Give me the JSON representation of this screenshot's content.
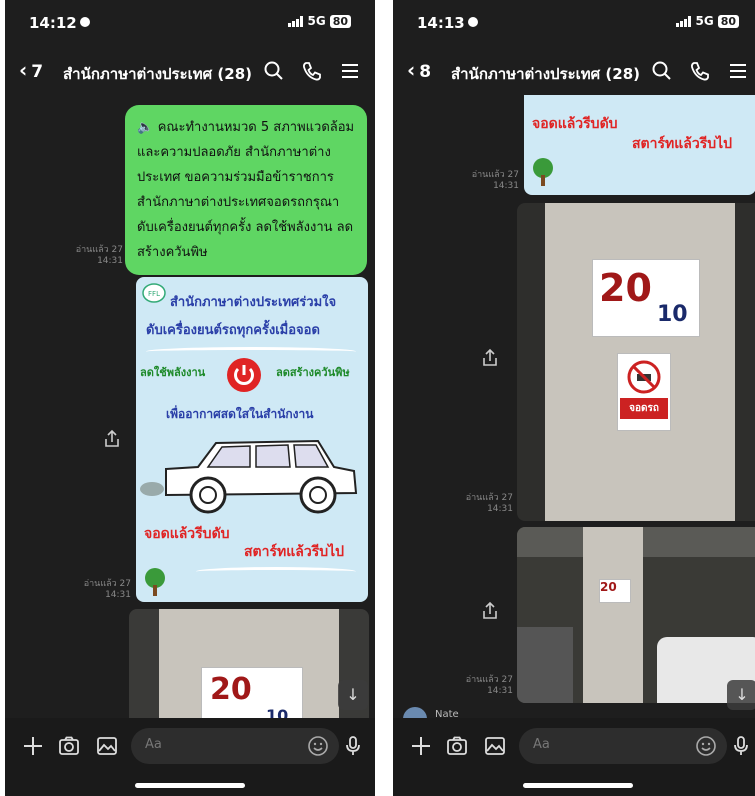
{
  "left": {
    "time": "14:12",
    "network": "5G",
    "battery": "80",
    "back_count": "7",
    "chat_title": "สำนักภาษาต่างประเทศ (28)",
    "message_text": "คณะทำงานหมวด 5 สภาพแวดล้อมและความปลอดภัย สำนักภาษาต่างประเทศ ขอความร่วมมือข้าราชการสำนักภาษาต่างประเทศจอดรถกรุณาดับเครื่องยนต์ทุกครั้ง ลดใช้พลังงาน ลดสร้างควันพิษ",
    "read_label": "อ่านแล้ว 27",
    "read_time": "14:31",
    "poster": {
      "title": "สำนักภาษาต่างประเทศร่วมใจ",
      "line2": "ดับเครื่องยนต์รถทุกครั้งเมื่อจอด",
      "left_text": "ลดใช้พลังงาน",
      "right_text": "ลดสร้างควันพิษ",
      "line4": "เพื่ออากาศสดใสในสำนักงาน",
      "slogan1": "จอดแล้วรีบดับ",
      "slogan2": "สตาร์ทแล้วรีบไป"
    },
    "pillar_number": "20",
    "pillar_sub": "10",
    "input_placeholder": "Aa"
  },
  "right": {
    "time": "14:13",
    "network": "5G",
    "battery": "80",
    "back_count": "8",
    "chat_title": "สำนักภาษาต่างประเทศ (28)",
    "read_label": "อ่านแล้ว 27",
    "read_time": "14:31",
    "slogan1": "จอดแล้วรีบดับ",
    "slogan2": "สตาร์ทแล้วรีบไป",
    "pillar_number": "20",
    "pillar_sub": "10",
    "nopark_text": "จอดรถ",
    "sender_name": "Nate",
    "input_placeholder": "Aa"
  },
  "colors": {
    "background": "#1e1e1e",
    "bubble_green": "#5fd663",
    "poster_blue": "#cfe9f5",
    "slogan_red": "#e02424",
    "title_blue": "#2a3fa8"
  }
}
